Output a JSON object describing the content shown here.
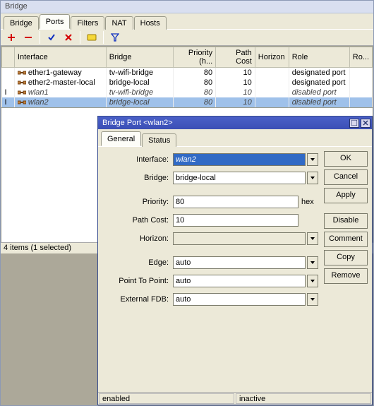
{
  "window": {
    "title": "Bridge"
  },
  "tabs": [
    "Bridge",
    "Ports",
    "Filters",
    "NAT",
    "Hosts"
  ],
  "active_tab": "Ports",
  "toolbar_icons": [
    "add-icon",
    "remove-icon",
    "enable-icon",
    "disable-icon",
    "comment-icon",
    "filter-icon"
  ],
  "columns": [
    "",
    "Interface",
    "Bridge",
    "Priority (h...",
    "Path Cost",
    "Horizon",
    "Role",
    "Ro..."
  ],
  "rows": [
    {
      "flag": "",
      "iface": "ether1-gateway",
      "bridge": "tv-wifi-bridge",
      "prio": "80",
      "cost": "10",
      "horizon": "",
      "role": "designated port",
      "italic": false
    },
    {
      "flag": "",
      "iface": "ether2-master-local",
      "bridge": "bridge-local",
      "prio": "80",
      "cost": "10",
      "horizon": "",
      "role": "designated port",
      "italic": false
    },
    {
      "flag": "I",
      "iface": "wlan1",
      "bridge": "tv-wifi-bridge",
      "prio": "80",
      "cost": "10",
      "horizon": "",
      "role": "disabled port",
      "italic": true
    },
    {
      "flag": "I",
      "iface": "wlan2",
      "bridge": "bridge-local",
      "prio": "80",
      "cost": "10",
      "horizon": "",
      "role": "disabled port",
      "italic": true,
      "selected": true
    }
  ],
  "statusbar": "4 items (1 selected)",
  "dialog": {
    "title": "Bridge Port <wlan2>",
    "tabs": [
      "General",
      "Status"
    ],
    "active_tab": "General",
    "fields": {
      "interface_label": "Interface:",
      "interface": "wlan2",
      "bridge_label": "Bridge:",
      "bridge": "bridge-local",
      "priority_label": "Priority:",
      "priority": "80",
      "priority_unit": "hex",
      "pathcost_label": "Path Cost:",
      "pathcost": "10",
      "horizon_label": "Horizon:",
      "horizon": "",
      "edge_label": "Edge:",
      "edge": "auto",
      "ptp_label": "Point To Point:",
      "ptp": "auto",
      "extfdb_label": "External FDB:",
      "extfdb": "auto"
    },
    "buttons": [
      "OK",
      "Cancel",
      "Apply",
      "Disable",
      "Comment",
      "Copy",
      "Remove"
    ],
    "status_left": "enabled",
    "status_right": "inactive"
  }
}
